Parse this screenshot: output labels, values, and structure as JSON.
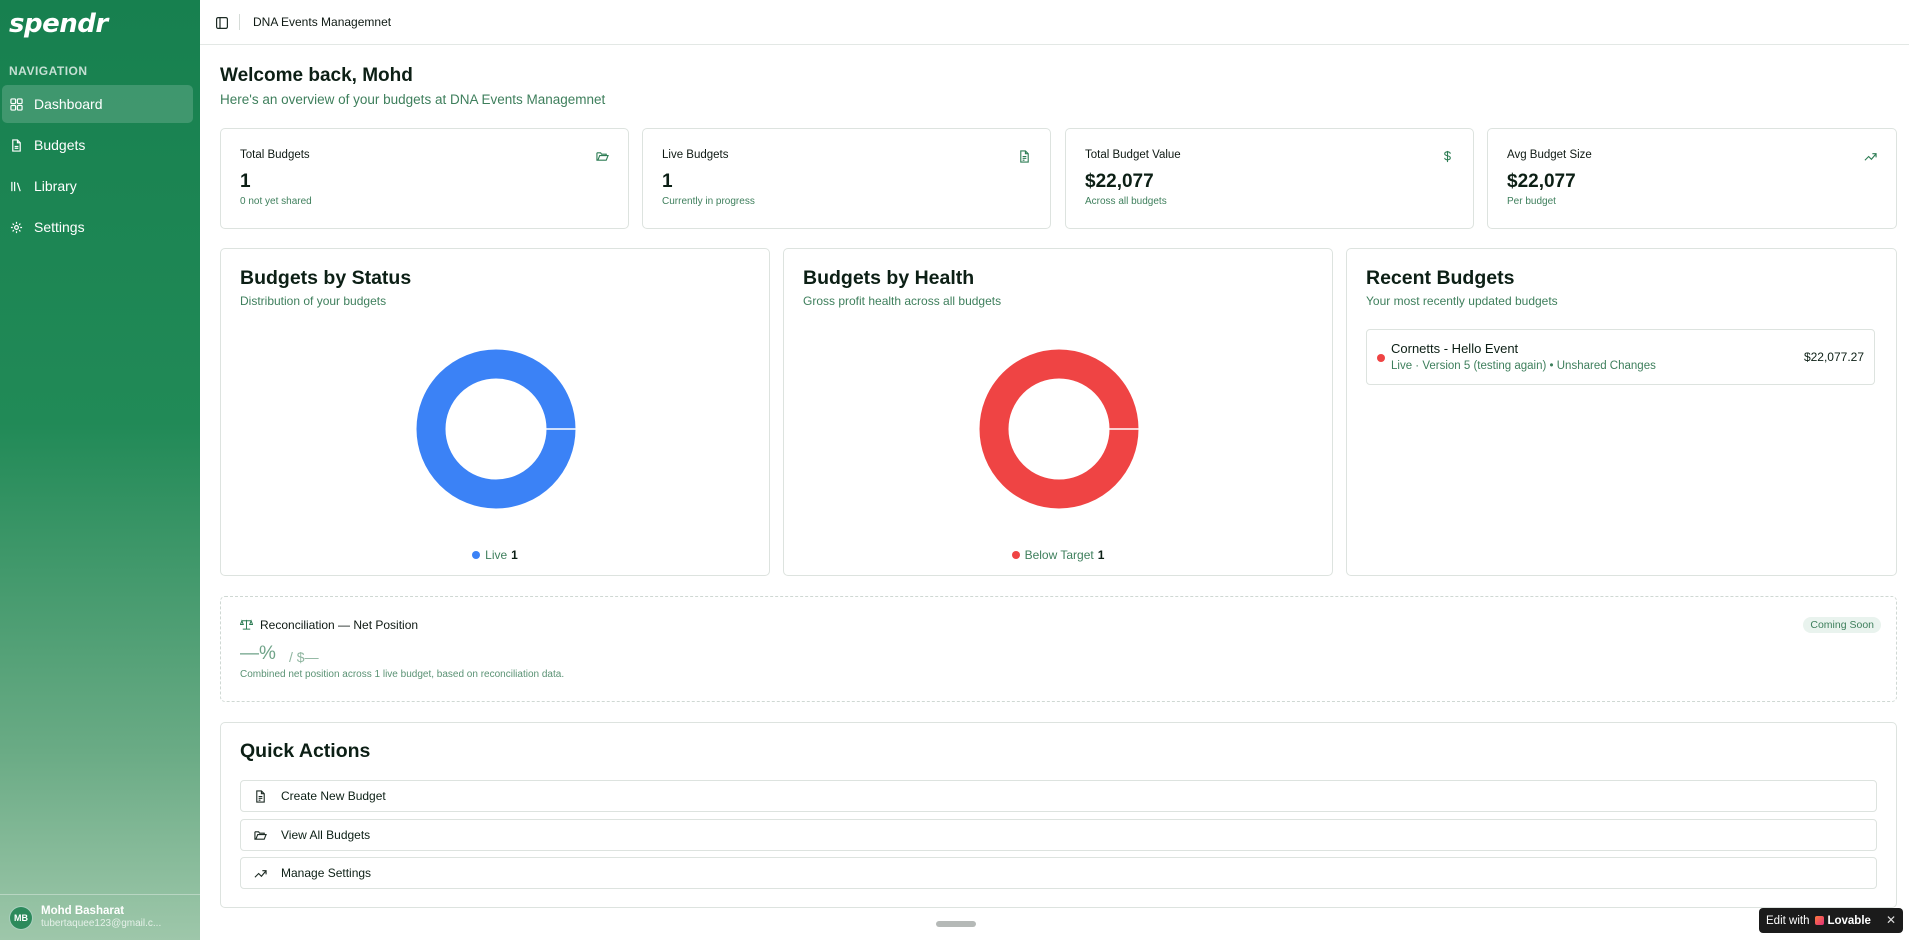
{
  "app": {
    "logo": "spendr",
    "org_name": "DNA Events Managemnet"
  },
  "sidebar": {
    "section_label": "NAVIGATION",
    "items": [
      {
        "label": "Dashboard",
        "icon": "grid-icon",
        "active": true
      },
      {
        "label": "Budgets",
        "icon": "file-icon"
      },
      {
        "label": "Library",
        "icon": "library-icon"
      },
      {
        "label": "Settings",
        "icon": "gear-icon"
      }
    ],
    "user": {
      "initials": "MB",
      "name": "Mohd Basharat",
      "email": "tubertaquee123@gmail.c..."
    }
  },
  "header": {
    "title": "Welcome back, Mohd",
    "subtitle": "Here's an overview of your budgets at DNA Events Managemnet"
  },
  "stats": [
    {
      "title": "Total Budgets",
      "value": "1",
      "sub": "0 not yet shared",
      "icon": "folder-open-icon"
    },
    {
      "title": "Live Budgets",
      "value": "1",
      "sub": "Currently in progress",
      "icon": "file-text-icon"
    },
    {
      "title": "Total Budget Value",
      "value": "$22,077",
      "sub": "Across all budgets",
      "icon": "dollar-icon"
    },
    {
      "title": "Avg Budget Size",
      "value": "$22,077",
      "sub": "Per budget",
      "icon": "trending-up-icon"
    }
  ],
  "status_panel": {
    "title": "Budgets by Status",
    "subtitle": "Distribution of your budgets",
    "legend": [
      {
        "label": "Live",
        "count": "1",
        "color": "#3b82f6"
      }
    ]
  },
  "health_panel": {
    "title": "Budgets by Health",
    "subtitle": "Gross profit health across all budgets",
    "legend": [
      {
        "label": "Below Target",
        "count": "1",
        "color": "#ef4444"
      }
    ]
  },
  "recent_panel": {
    "title": "Recent Budgets",
    "subtitle": "Your most recently updated budgets",
    "items": [
      {
        "name": "Cornetts - Hello Event",
        "meta": "Live · Version 5 (testing again) • Unshared Changes",
        "amount": "$22,077.27",
        "status_color": "#ef4444"
      }
    ]
  },
  "reconciliation": {
    "title": "Reconciliation — Net Position",
    "badge": "Coming Soon",
    "value": "—%",
    "value_secondary": "/ $—",
    "note": "Combined net position across 1 live budget, based on reconciliation data."
  },
  "quick_actions": {
    "title": "Quick Actions",
    "items": [
      {
        "label": "Create New Budget",
        "icon": "file-plus-icon"
      },
      {
        "label": "View All Budgets",
        "icon": "folder-open-icon"
      },
      {
        "label": "Manage Settings",
        "icon": "trending-up-icon"
      }
    ]
  },
  "lovable_badge": {
    "prefix": "Edit with",
    "brand": "Lovable",
    "close": "✕"
  },
  "colors": {
    "brand_green": "#17804f",
    "accent_text": "#3e7f5c",
    "live_blue": "#3b82f6",
    "below_red": "#ef4444"
  }
}
